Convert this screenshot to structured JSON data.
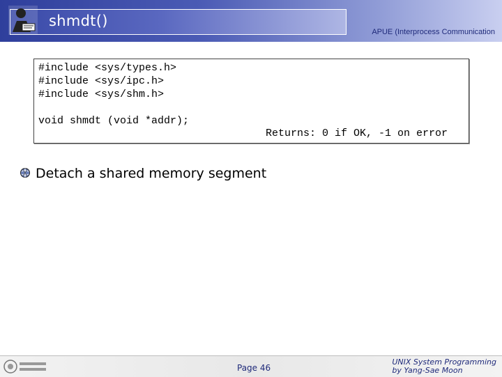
{
  "header": {
    "title": "shmdt()",
    "subtitle": "APUE (Interprocess Communication"
  },
  "code": {
    "lines": [
      "#include <sys/types.h>",
      "#include <sys/ipc.h>",
      "#include <sys/shm.h>",
      "",
      "void shmdt (void *addr);"
    ],
    "returns": "Returns: 0 if OK, -1 on error"
  },
  "bullets": [
    {
      "icon": "globe-icon",
      "text": "Detach a shared memory segment"
    }
  ],
  "footer": {
    "page": "Page 46",
    "course_line1": "UNIX System Programming",
    "course_line2": "by Yang-Sae Moon"
  }
}
